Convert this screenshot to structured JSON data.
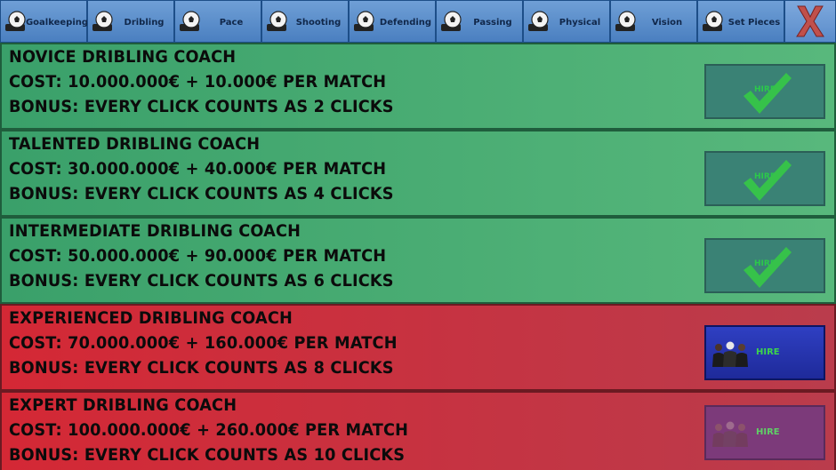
{
  "tabs": [
    {
      "label": "Goalkeeping",
      "icon": "soccer-ball-boot-icon"
    },
    {
      "label": "Dribling",
      "icon": "soccer-ball-boot-icon"
    },
    {
      "label": "Pace",
      "icon": "soccer-ball-boot-icon"
    },
    {
      "label": "Shooting",
      "icon": "soccer-ball-boot-icon"
    },
    {
      "label": "Defending",
      "icon": "soccer-ball-boot-icon"
    },
    {
      "label": "Passing",
      "icon": "soccer-ball-boot-icon"
    },
    {
      "label": "Physical",
      "icon": "soccer-ball-boot-icon"
    },
    {
      "label": "Vision",
      "icon": "soccer-ball-boot-icon"
    },
    {
      "label": "Set Pieces",
      "icon": "soccer-ball-boot-icon"
    }
  ],
  "close_icon": "close-x-icon",
  "coaches": [
    {
      "name": "NOVICE DRIBLING COACH",
      "cost": "COST: 10.000.000€ + 10.000€ PER MATCH",
      "bonus": "BONUS: EVERY CLICK COUNTS AS 2 CLICKS",
      "button": "HIRE",
      "state": "hired"
    },
    {
      "name": "TALENTED DRIBLING COACH",
      "cost": "COST: 30.000.000€ + 40.000€ PER MATCH",
      "bonus": "BONUS: EVERY CLICK COUNTS AS 4 CLICKS",
      "button": "HIRE",
      "state": "hired"
    },
    {
      "name": "INTERMEDIATE DRIBLING COACH",
      "cost": "COST: 50.000.000€ + 90.000€ PER MATCH",
      "bonus": "BONUS: EVERY CLICK COUNTS AS 6 CLICKS",
      "button": "HIRE",
      "state": "hired"
    },
    {
      "name": "EXPERIENCED DRIBLING COACH",
      "cost": "COST: 70.000.000€ + 160.000€ PER MATCH",
      "bonus": "BONUS: EVERY CLICK COUNTS AS 8 CLICKS",
      "button": "HIRE",
      "state": "available"
    },
    {
      "name": "EXPERT DRIBLING COACH",
      "cost": "COST: 100.000.000€ + 260.000€ PER MATCH",
      "bonus": "BONUS: EVERY CLICK COUNTS AS 10 CLICKS",
      "button": "HIRE",
      "state": "locked"
    }
  ],
  "colors": {
    "tab_bg": "#5b8fcc",
    "row_hired": "#4aac72",
    "row_not_hired": "#c83040",
    "hire_done": "#3a8275",
    "hire_active": "#2535ae",
    "hire_locked": "#7c3a7a",
    "hire_text": "#2bc94a"
  }
}
